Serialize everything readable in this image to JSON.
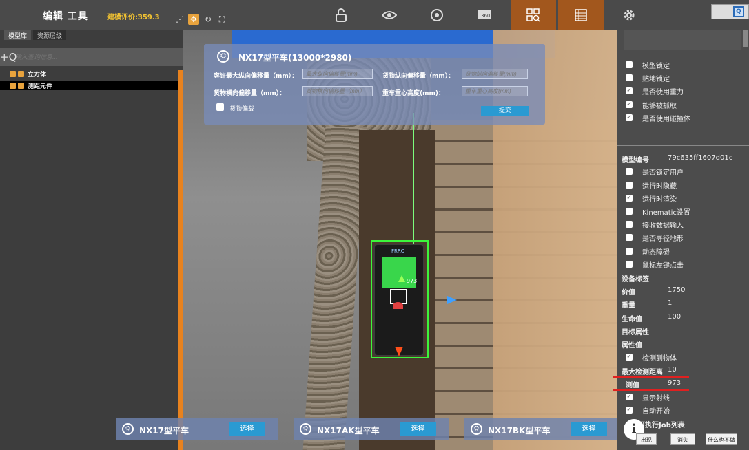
{
  "topbar": {
    "title": "编辑  工具",
    "score": "建模评价:359.3",
    "tools": [
      "share-tool-icon",
      "move-tool-icon",
      "rotate-tool-icon",
      "scale-tool-icon"
    ],
    "buttons": [
      "lock-icon",
      "eye-icon",
      "orbit-icon",
      "panorama-360-icon",
      "grid-search-icon",
      "table-icon",
      "gear-icon"
    ],
    "win_icon": "Q"
  },
  "left": {
    "tabs": [
      "模型库",
      "资源层级"
    ],
    "search_plus": "+Q",
    "search_placeholder": "输入查询信息...",
    "tree": [
      {
        "label": "立方体",
        "selected": false
      },
      {
        "label": "测距元件",
        "selected": true
      }
    ]
  },
  "vehicle_panel": {
    "title": "NX17型平车(13000*2980)",
    "fields": [
      {
        "label": "容许最大纵向偏移量（mm）：",
        "placeholder": "最大纵向偏移量(mm)"
      },
      {
        "label": "货物纵向偏移量（mm）：",
        "placeholder": "货物纵向偏移量(mm)"
      },
      {
        "label": "货物横向偏移量（mm）：",
        "placeholder": "货物横向偏移量（mm）"
      },
      {
        "label": "重车重心高度(mm)：",
        "placeholder": "重车重心高度(mm)"
      }
    ],
    "checkbox_label": "货物偏载",
    "submit": "提交"
  },
  "scene": {
    "gizmo_value": "973",
    "device_brand": "FRRO"
  },
  "vehicle_selectors": [
    {
      "name": "NX17型平车",
      "button": "选择"
    },
    {
      "name": "NX17AK型平车",
      "button": "选择"
    },
    {
      "name": "NX17BK型平车",
      "button": "选择"
    }
  ],
  "right": {
    "top_checks": [
      {
        "label": "模型锁定",
        "checked": false
      },
      {
        "label": "贴地锁定",
        "checked": false
      },
      {
        "label": "是否使用重力",
        "checked": true
      },
      {
        "label": "能够被抓取",
        "checked": true
      },
      {
        "label": "是否使用碰撞体",
        "checked": true
      }
    ],
    "model_id_label": "模型编号",
    "model_id_value": "79c635ff1607d01c",
    "mid_checks": [
      {
        "label": "是否锁定用户",
        "checked": false
      },
      {
        "label": "运行时隐藏",
        "checked": false
      },
      {
        "label": "运行时渲染",
        "checked": true
      },
      {
        "label": "Kinematic设置",
        "checked": false
      },
      {
        "label": "接收数据输入",
        "checked": false
      },
      {
        "label": "是否寻径地形",
        "checked": false
      },
      {
        "label": "动态障碍",
        "checked": false
      },
      {
        "label": "鼠标左键点击",
        "checked": false
      }
    ],
    "device_tag_label": "设备标签",
    "value_label": "价值",
    "value_value": "1750",
    "weight_label": "重量",
    "weight_value": "1",
    "hp_label": "生命值",
    "hp_value": "100",
    "target_attr_label": "目标属性",
    "attr_label": "属性值",
    "detect_label": "检测到物体",
    "max_dist_label": "最大检测距离",
    "max_dist_value": "10",
    "measured_label": "测值",
    "measured_value": "973",
    "show_ray_label": "显示射线",
    "auto_start_label": "自动开始",
    "job_list_label": "可执行Job列表",
    "info": "i",
    "btn_appear": "出现",
    "btn_disappear": "消失",
    "btn_nothing": "什么也不做"
  }
}
